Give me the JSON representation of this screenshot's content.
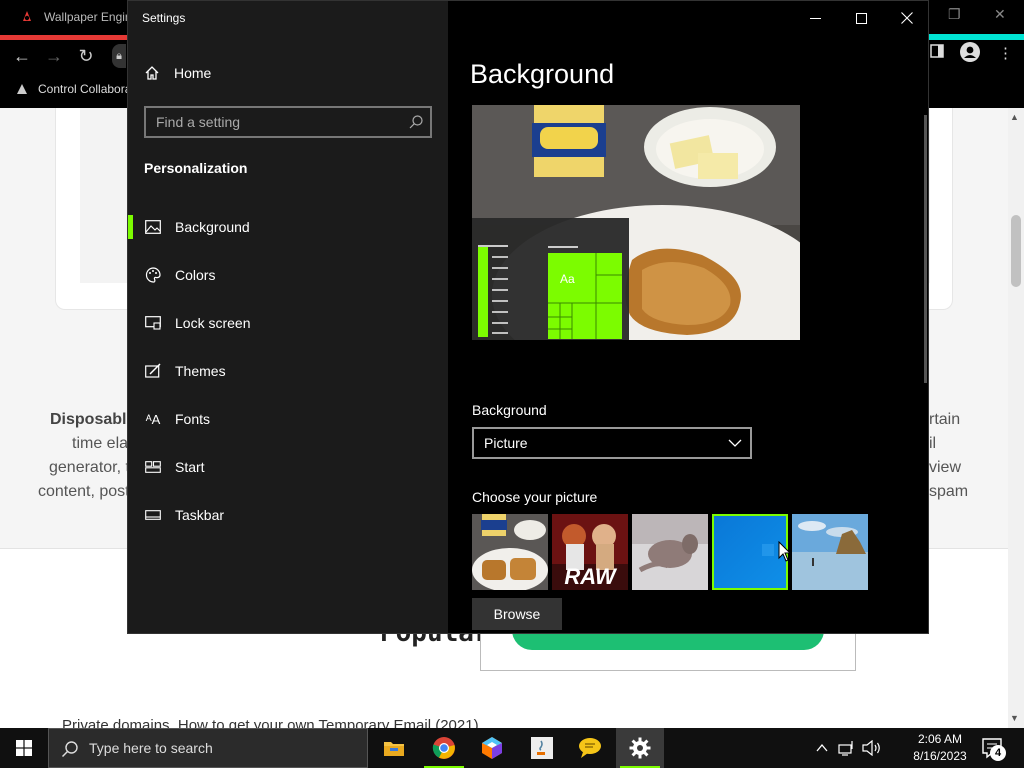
{
  "browser": {
    "tab_title": "Wallpaper Engine",
    "bookmark": "Control Collabora",
    "page": {
      "para_left": [
        "Disposabl",
        "time ela",
        "generator, t",
        "content, post"
      ],
      "para_right": [
        "rtain",
        "il",
        "view",
        "spam"
      ],
      "popular": "Popular",
      "bottom_text": "Private domains. How to get your own Temporary Email (2021)"
    }
  },
  "settings": {
    "window_title": "Settings",
    "home_label": "Home",
    "search_placeholder": "Find a setting",
    "section_title": "Personalization",
    "nav": [
      {
        "label": "Background",
        "icon": "picture-icon",
        "active": true
      },
      {
        "label": "Colors",
        "icon": "palette-icon",
        "active": false
      },
      {
        "label": "Lock screen",
        "icon": "lock-screen-icon",
        "active": false
      },
      {
        "label": "Themes",
        "icon": "themes-brush-icon",
        "active": false
      },
      {
        "label": "Fonts",
        "icon": "fonts-icon",
        "active": false
      },
      {
        "label": "Start",
        "icon": "start-icon",
        "active": false
      },
      {
        "label": "Taskbar",
        "icon": "taskbar-icon",
        "active": false
      }
    ],
    "content": {
      "heading": "Background",
      "preview_tile_text": "Aa",
      "background_label": "Background",
      "background_value": "Picture",
      "choose_picture_label": "Choose your picture",
      "pictures": [
        {
          "name": "mayonnaise-sandwich",
          "selected": false
        },
        {
          "name": "raw-wrestling",
          "selected": false
        },
        {
          "name": "cat-photo",
          "selected": false
        },
        {
          "name": "blue-solid",
          "selected": true
        },
        {
          "name": "beach-rocks",
          "selected": false
        }
      ],
      "browse_label": "Browse"
    },
    "accent_color": "#7cfc00"
  },
  "taskbar": {
    "search_placeholder": "Type here to search",
    "time": "2:06 AM",
    "date": "8/16/2023",
    "notification_count": "4",
    "apps": [
      "file-explorer",
      "chrome",
      "app-3d",
      "java",
      "chat",
      "settings"
    ]
  }
}
